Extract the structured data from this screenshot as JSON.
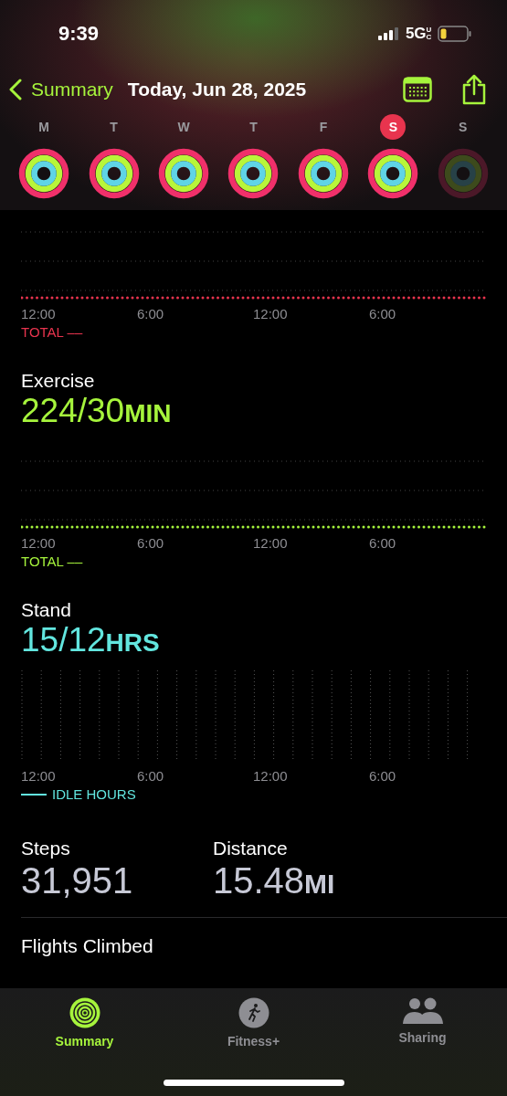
{
  "status_bar": {
    "time": "9:39",
    "network": "5G",
    "network_badge": "UC"
  },
  "nav": {
    "back": "Summary",
    "title": "Today, Jun 28, 2025"
  },
  "week": [
    {
      "label": "M",
      "selected": false,
      "future": false
    },
    {
      "label": "T",
      "selected": false,
      "future": false
    },
    {
      "label": "W",
      "selected": false,
      "future": false
    },
    {
      "label": "T",
      "selected": false,
      "future": false
    },
    {
      "label": "F",
      "selected": false,
      "future": false
    },
    {
      "label": "S",
      "selected": true,
      "future": false
    },
    {
      "label": "S",
      "selected": false,
      "future": true
    }
  ],
  "metrics": [
    {
      "kind": "lines",
      "color": "#e8344e",
      "axis": [
        "12:00",
        "6:00",
        "12:00",
        "6:00"
      ],
      "legend": "TOTAL ––"
    },
    {
      "kind": "lines",
      "title": "Exercise",
      "value": "224/30",
      "unit": "MIN",
      "color": "#a6f43c",
      "axis": [
        "12:00",
        "6:00",
        "12:00",
        "6:00"
      ],
      "legend": "TOTAL ––"
    },
    {
      "kind": "bars",
      "title": "Stand",
      "value": "15/12",
      "unit": "HRS",
      "color": "#62e6df",
      "axis": [
        "12:00",
        "6:00",
        "12:00",
        "6:00"
      ],
      "legend": "IDLE HOURS"
    }
  ],
  "stats": [
    {
      "label": "Steps",
      "value": "31,951"
    },
    {
      "label": "Distance",
      "value": "15.48",
      "unit": "MI"
    }
  ],
  "extra_stat": {
    "label": "Flights Climbed"
  },
  "tabs": [
    {
      "label": "Summary",
      "selected": true,
      "kind": "rings"
    },
    {
      "label": "Fitness+",
      "selected": false,
      "kind": "runner"
    },
    {
      "label": "Sharing",
      "selected": false,
      "kind": "people"
    }
  ]
}
